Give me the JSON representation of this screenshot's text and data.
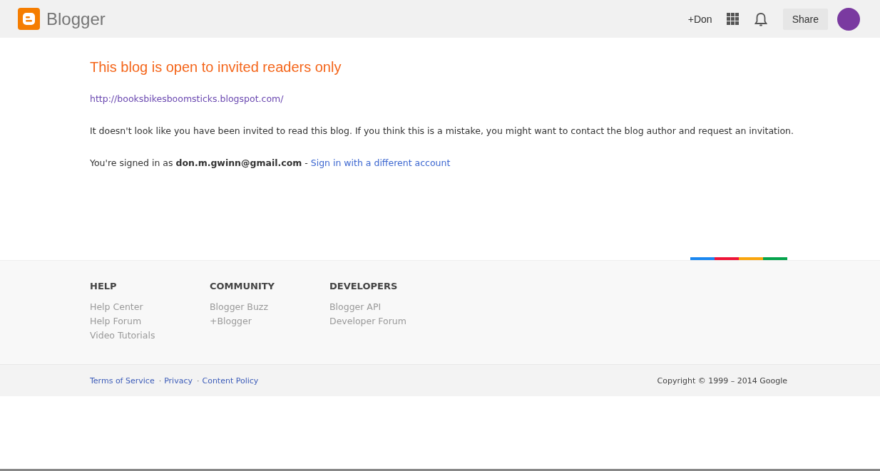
{
  "header": {
    "brand": "Blogger",
    "profile_link": "+Don",
    "share_button": "Share"
  },
  "message": {
    "title": "This blog is open to invited readers only",
    "blog_url": "http://booksbikesboomsticks.blogspot.com/",
    "body": "It doesn't look like you have been invited to read this blog. If you think this is a mistake, you might want to contact the blog author and request an invitation.",
    "signed_in": "You're signed in as **don.m.gwinn@gmail.com** -",
    "switch_account_link": "Sign in with a different account"
  },
  "footer": {
    "columns": [
      {
        "heading": "HELP",
        "links": [
          "Help Center",
          "Help Forum",
          "Video Tutorials"
        ]
      },
      {
        "heading": "COMMUNITY",
        "links": [
          "Blogger Buzz",
          "+Blogger"
        ]
      },
      {
        "heading": "DEVELOPERS",
        "links": [
          "Blogger API",
          "Developer Forum"
        ]
      }
    ],
    "bottom_links": [
      "Terms of Service",
      "Privacy",
      "Content Policy"
    ],
    "separator": "·",
    "copyright": "Copyright © 1999 – 2014 Google"
  }
}
